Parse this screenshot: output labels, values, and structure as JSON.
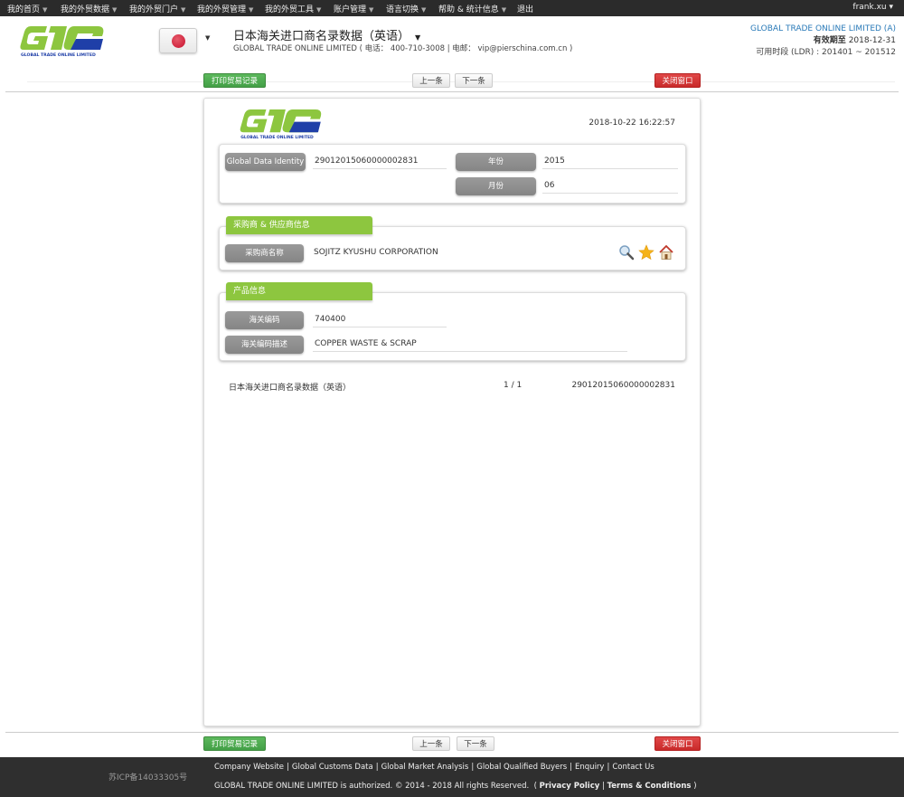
{
  "topnav": {
    "items": [
      {
        "label": "我的首页",
        "has_caret": true
      },
      {
        "label": "我的外贸数据",
        "has_caret": true
      },
      {
        "label": "我的外贸门户",
        "has_caret": true
      },
      {
        "label": "我的外贸管理",
        "has_caret": true
      },
      {
        "label": "我的外贸工具",
        "has_caret": true
      },
      {
        "label": "账户管理",
        "has_caret": true
      },
      {
        "label": "语言切换",
        "has_caret": true
      },
      {
        "label": "帮助 & 统计信息",
        "has_caret": true
      },
      {
        "label": "退出",
        "has_caret": false
      }
    ],
    "caret": "▼",
    "user": "frank.xu ▾"
  },
  "header": {
    "logo_text": "GLOBAL TRADE ONLINE LIMITED",
    "flag": "japan-flag",
    "db_title": "日本海关进口商名录数据（英语）",
    "db_caret": "▼",
    "company_line": "GLOBAL TRADE ONLINE LIMITED ( 电话： 400-710-3008 | 电邮： vip@pierschina.com.cn )",
    "account_name": "GLOBAL TRADE ONLINE LIMITED (A)",
    "expiry_label": "有效期至",
    "expiry_date": "2018-12-31",
    "ldr": "可用时段 (LDR) : 201401 ~ 201512"
  },
  "actions": {
    "print_label": "打印贸易记录",
    "prev_label": "上一条",
    "next_label": "下一条",
    "close_label": "关闭窗口"
  },
  "record": {
    "logo_text": "GLOBAL TRADE ONLINE LIMITED",
    "timestamp": "2018-10-22 16:22:57",
    "identity": {
      "gdi_label": "Global Data Identity",
      "gdi_value": "29012015060000002831",
      "year_label": "年份",
      "year_value": "2015",
      "month_label": "月份",
      "month_value": "06"
    },
    "parties": {
      "tab_label": "采购商 & 供应商信息",
      "buyer_label": "采购商名称",
      "buyer_value": "SOJITZ KYUSHU CORPORATION",
      "icons": [
        "search-icon",
        "star-icon",
        "home-icon"
      ]
    },
    "product": {
      "tab_label": "产品信息",
      "hs_label": "海关编码",
      "hs_value": "740400",
      "hs_desc_label": "海关编码描述",
      "hs_desc_value": "COPPER WASTE & SCRAP"
    },
    "footer": {
      "source": "日本海关进口商名录数据（英语）",
      "page": "1 / 1",
      "id": "29012015060000002831"
    }
  },
  "footer": {
    "icp": "苏ICP备14033305号",
    "links": [
      "Company Website",
      "Global Customs Data",
      "Global Market Analysis",
      "Global Qualified Buyers",
      "Enquiry",
      "Contact Us"
    ],
    "copyright": "GLOBAL TRADE ONLINE LIMITED is authorized. © 2014 - 2018 All rights Reserved.",
    "privacy": "Privacy Policy",
    "terms": "Terms & Conditions"
  },
  "colors": {
    "nav_bg": "#2b2b2b",
    "accent_blue": "#2a7ab8",
    "tab_green": "#8dc63f",
    "btn_green": "#4cae4c",
    "btn_red": "#d43f3f",
    "pill_gray": "#8f8f8f",
    "footer_bg": "#2f2f2f",
    "logo_green": "#8dc63f",
    "logo_blue": "#1a3a9a"
  }
}
